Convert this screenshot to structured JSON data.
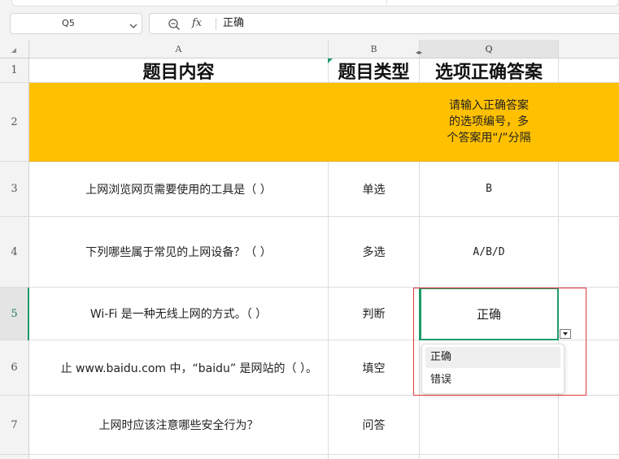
{
  "name_box": {
    "value": "Q5"
  },
  "formula_bar": {
    "content": "正确",
    "fx_label": "fx"
  },
  "columns": [
    {
      "key": "rownum",
      "label": ""
    },
    {
      "key": "A",
      "label": "A"
    },
    {
      "key": "B",
      "label": "B"
    },
    {
      "key": "Q",
      "label": "Q",
      "active": true
    },
    {
      "key": "next",
      "label": ""
    }
  ],
  "rows": [
    {
      "num": "1",
      "A": "题目内容",
      "B": "题目类型",
      "Q": "选项正确答案"
    },
    {
      "num": "2",
      "A": "",
      "B": "",
      "Q_lines": [
        "请输入正确答案",
        "的选项编号，多",
        "个答案用“/”分隔"
      ]
    },
    {
      "num": "3",
      "A": "上网浏览网页需要使用的工具是（ ）",
      "B": "单选",
      "Q": "B"
    },
    {
      "num": "4",
      "A": "下列哪些属于常见的上网设备？（ ）",
      "B": "多选",
      "Q": "A/B/D"
    },
    {
      "num": "5",
      "A": "Wi-Fi 是一种无线上网的方式。（ ）",
      "B": "判断",
      "Q": "正确"
    },
    {
      "num": "6",
      "A": "止 www.baidu.com 中，“baidu” 是网站的（ ）。",
      "B": "填空",
      "Q": ""
    },
    {
      "num": "7",
      "A": "上网时应该注意哪些安全行为？",
      "B": "问答",
      "Q": ""
    }
  ],
  "dropdown": {
    "options": [
      "正确",
      "错误"
    ],
    "selected": "正确"
  },
  "colors": {
    "header_fill": "#ffc000",
    "selection": "#1e9b6a",
    "annotation": "#e03a3a"
  }
}
